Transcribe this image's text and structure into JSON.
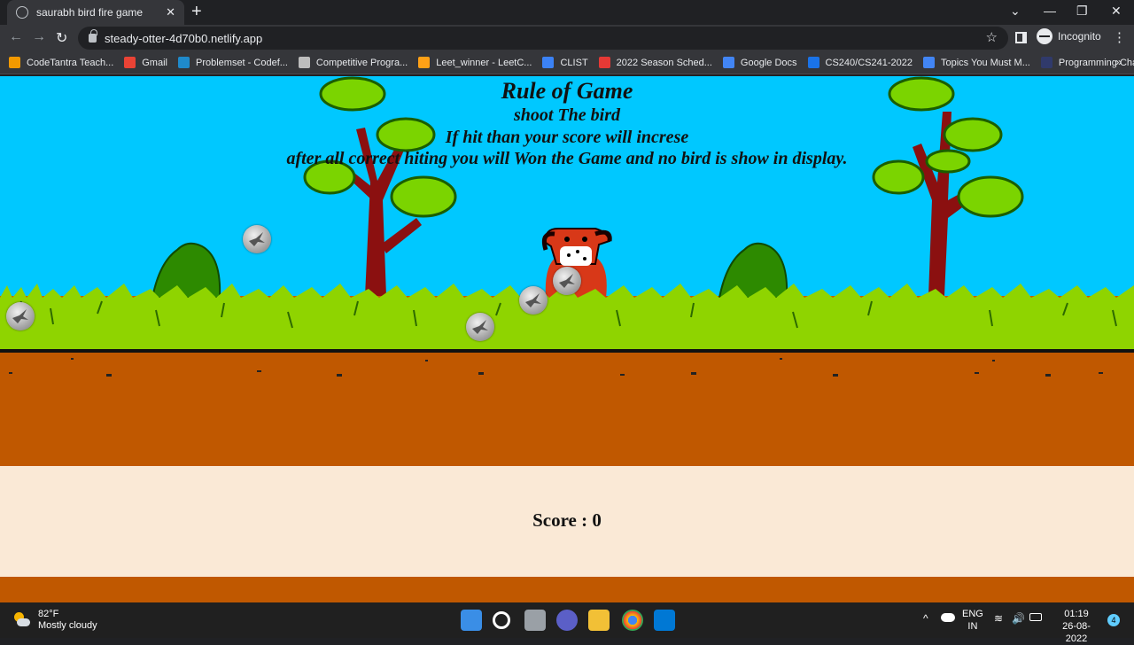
{
  "browser": {
    "tab_title": "saurabh bird fire game",
    "url": "steady-otter-4d70b0.netlify.app",
    "profile_label": "Incognito",
    "bookmarks": [
      {
        "label": "CodeTantra Teach...",
        "color": "#f29900"
      },
      {
        "label": "Gmail",
        "color": "#ea4335"
      },
      {
        "label": "Problemset - Codef...",
        "color": "#1f8acb"
      },
      {
        "label": "Competitive Progra...",
        "color": "#bdbdbd"
      },
      {
        "label": "Leet_winner - LeetC...",
        "color": "#ffa116"
      },
      {
        "label": "CLIST",
        "color": "#3b82f6"
      },
      {
        "label": "2022 Season Sched...",
        "color": "#e53935"
      },
      {
        "label": "Google Docs",
        "color": "#4285f4"
      },
      {
        "label": "CS240/CS241-2022",
        "color": "#1a73e8"
      },
      {
        "label": "Topics You Must M...",
        "color": "#4285f4"
      },
      {
        "label": "Programming Chall...",
        "color": "#303a6b"
      }
    ]
  },
  "game": {
    "rules_heading": "Rule of Game",
    "rule_1": "shoot The bird",
    "rule_2": "If hit than your score will increse",
    "rule_3": "after all correct hiting you will Won the Game and no bird is show in display.",
    "score_label": "Score : 0",
    "colors": {
      "sky": "#00c8ff",
      "grass": "#8fd400",
      "dirt": "#c05800",
      "score_bg": "#fae9d6"
    }
  },
  "taskbar": {
    "temperature": "82°F",
    "weather": "Mostly cloudy",
    "lang_1": "ENG",
    "lang_2": "IN",
    "time": "01:19",
    "date": "26-08-2022",
    "notifications": "4"
  }
}
